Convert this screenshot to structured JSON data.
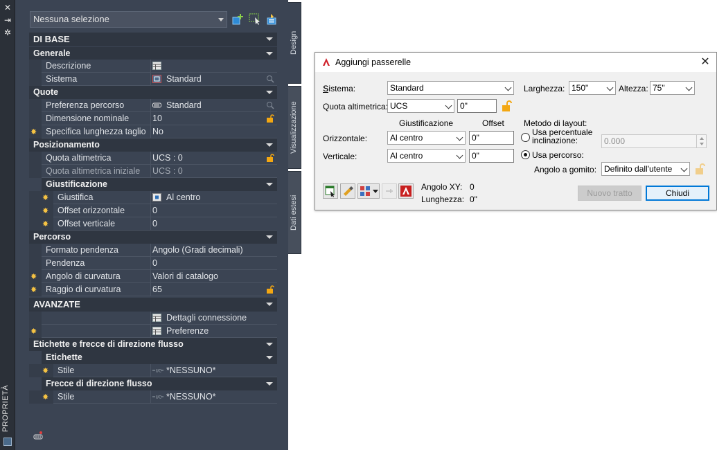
{
  "palette": {
    "title": "PROPRIETÀ",
    "tabs": {
      "design": "Design",
      "visualizzazione": "Visualizzazione",
      "dati_estesi": "Dati estesi"
    },
    "selection": "Nessuna selezione",
    "sections": {
      "di_base": "DI BASE",
      "generale": "Generale",
      "descrizione": "Descrizione",
      "sistema_label": "Sistema",
      "sistema_value": "Standard",
      "quote": "Quote",
      "pref_percorso_label": "Preferenza percorso",
      "pref_percorso_value": "Standard",
      "dim_nominale_label": "Dimensione nominale",
      "dim_nominale_value": "10",
      "spec_taglio_label": "Specifica lunghezza taglio",
      "spec_taglio_value": "No",
      "posizionamento": "Posizionamento",
      "quota_alt_label": "Quota altimetrica",
      "quota_alt_value": "UCS : 0",
      "quota_alt_ini_label": "Quota altimetrica iniziale",
      "quota_alt_ini_value": "UCS : 0",
      "giustificazione": "Giustificazione",
      "giustifica_label": "Giustifica",
      "giustifica_value": "Al centro",
      "offset_orizz_label": "Offset orizzontale",
      "offset_orizz_value": "0",
      "offset_vert_label": "Offset verticale",
      "offset_vert_value": "0",
      "percorso": "Percorso",
      "formato_pend_label": "Formato pendenza",
      "formato_pend_value": "Angolo (Gradi decimali)",
      "pendenza_label": "Pendenza",
      "pendenza_value": "0",
      "angolo_curv_label": "Angolo di curvatura",
      "angolo_curv_value": "Valori di catalogo",
      "raggio_curv_label": "Raggio di curvatura",
      "raggio_curv_value": "65",
      "avanzate": "AVANZATE",
      "dettagli_conn": "Dettagli connessione",
      "preferenze": "Preferenze",
      "etichette_frecce": "Etichette e frecce di direzione flusso",
      "etichette": "Etichette",
      "stile_label": "Stile",
      "stile_value": "*NESSUNO*",
      "frecce": "Frecce di direzione flusso",
      "stile2_label": "Stile",
      "stile2_value": "*NESSUNO*"
    }
  },
  "dialog": {
    "title": "Aggiungi passerelle",
    "sistema_label": "Sistema:",
    "sistema_value": "Standard",
    "larghezza_label": "Larghezza:",
    "larghezza_value": "150\"",
    "altezza_label": "Altezza:",
    "altezza_value": "75\"",
    "quota_label": "Quota altimetrica:",
    "quota_combo": "UCS",
    "quota_value": "0\"",
    "giust_header": "Giustificazione",
    "offset_header": "Offset",
    "orizz_label": "Orizzontale:",
    "orizz_value": "Al centro",
    "orizz_offset": "0\"",
    "vert_label": "Verticale:",
    "vert_value": "Al centro",
    "vert_offset": "0\"",
    "metodo_label": "Metodo di layout:",
    "usa_perc_label_1": "Usa percentuale",
    "usa_perc_label_2": "inclinazione:",
    "usa_perc_value": "0.000",
    "usa_percorso_label": "Usa percorso:",
    "angolo_gomito_label": "Angolo a gomito:",
    "angolo_gomito_value": "Definito dall'utente",
    "angolo_xy_label": "Angolo XY:",
    "angolo_xy_value": "0",
    "lunghezza_label": "Lunghezza:",
    "lunghezza_value": "0\"",
    "nuovo_tratto": "Nuovo tratto",
    "chiudi": "Chiudi",
    "close_glyph": "✕"
  },
  "icons": {
    "close": "✕",
    "autohide": "⇥",
    "settings": "✲",
    "star": "✸"
  },
  "colors": {
    "palette_bg": "#3b4453",
    "category_bg": "#2f3641",
    "accent_star": "#f6c343",
    "dialog_default_border": "#0078d7"
  }
}
